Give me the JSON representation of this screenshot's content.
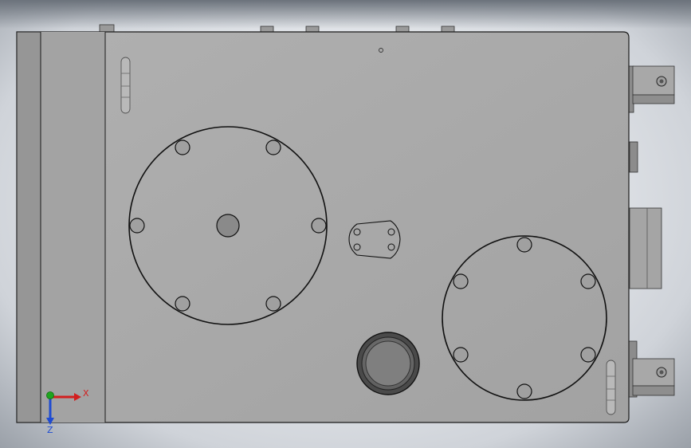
{
  "window": {
    "title": ""
  },
  "triad": {
    "x_label": "X",
    "z_label": "Z",
    "x_color": "#d21e1e",
    "y_color": "#1ea51e",
    "z_color": "#1e4bd2"
  },
  "colors": {
    "body": "#a7a7a7",
    "outline": "#1a1a1a",
    "background": "#e6e8eb"
  },
  "icons": {
    "triad": "axis-triad-icon"
  }
}
